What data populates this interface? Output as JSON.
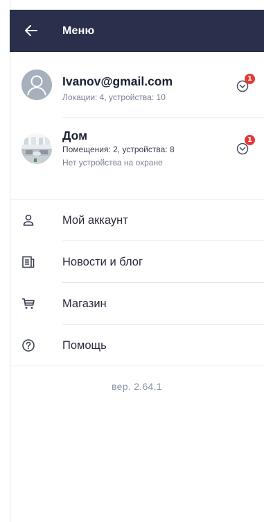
{
  "header": {
    "title": "Меню",
    "back_icon": "arrow-left-icon"
  },
  "colors": {
    "header_bg": "#2a2f4b",
    "badge": "#e53935",
    "accent_text": "#7a8092"
  },
  "account": {
    "email": "Ivanov@gmail.com",
    "subtitle": "Локации: 4, устройства: 10",
    "badge_count": "1",
    "avatar_icon": "user-avatar-icon",
    "expand_icon": "chevron-down-circle-icon"
  },
  "location": {
    "name": "Дом",
    "subtitle": "Помещения: 2, устройства: 8",
    "status": "Нет устройства на охране",
    "badge_count": "1",
    "expand_icon": "chevron-down-circle-icon"
  },
  "menu": {
    "items": [
      {
        "label": "Мой аккаунт",
        "icon": "user-icon"
      },
      {
        "label": "Новости и блог",
        "icon": "news-icon"
      },
      {
        "label": "Магазин",
        "icon": "cart-icon"
      },
      {
        "label": "Помощь",
        "icon": "help-icon"
      }
    ]
  },
  "version": "вер. 2.64.1"
}
